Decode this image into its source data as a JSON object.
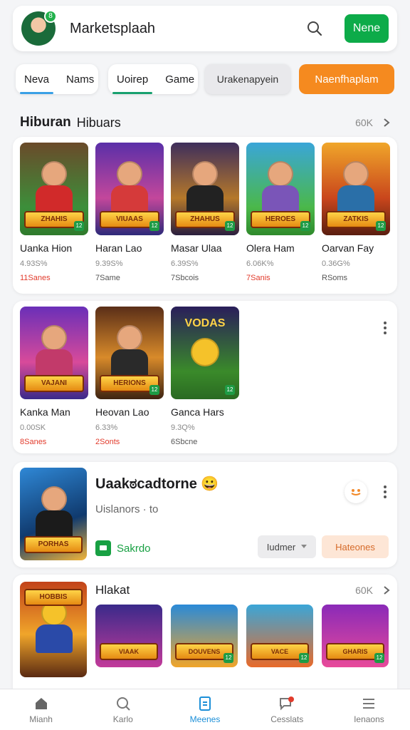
{
  "header": {
    "title": "Marketsplaah",
    "avatar_badge": "8",
    "cta_label": "Nene"
  },
  "chips": {
    "group1": [
      "Neva",
      "Nams"
    ],
    "group2": [
      "Uoirep",
      "Game"
    ],
    "grey": "Urakenapyein",
    "orange": "Naenfhaplam"
  },
  "section1": {
    "title": "Hiburan",
    "subtitle": "Hibuars",
    "more": "60K",
    "games": [
      {
        "name": "Uanka Hion",
        "rating": "4.93S%",
        "saves": "11Sanes",
        "red": true
      },
      {
        "name": "Haran Lao",
        "rating": "9.39S%",
        "saves": "7Same",
        "red": false
      },
      {
        "name": "Masar Ulaa",
        "rating": "6.39S%",
        "saves": "7Sbcois",
        "red": false
      },
      {
        "name": "Olera Ham",
        "rating": "6.06K%",
        "saves": "7Sanis",
        "red": true
      },
      {
        "name": "Oarvan Fay",
        "rating": "0.36G%",
        "saves": "RSoms",
        "red": false
      },
      {
        "name": "Kanka Man",
        "rating": "0.00SK",
        "saves": "8Sanes",
        "red": true
      },
      {
        "name": "Heovan Lao",
        "rating": "6.33%",
        "saves": "2Sonts",
        "red": true
      },
      {
        "name": "Ganca Hars",
        "rating": "9.3Q%",
        "saves": "6Sbcne",
        "red": false
      }
    ],
    "thumb_texts": [
      "ZHAHIS",
      "VIUAAS",
      "ZHAHUS",
      "HEROES",
      "ZATKIS",
      "VAJANI",
      "HERIONS",
      "VODAS"
    ]
  },
  "featured": {
    "title": "Uaakಠcadtorne 😀",
    "subtitle": "Uislanors  · to",
    "app_label": "Sakrdo",
    "dropdown": "Iudmer",
    "action": "Hateones",
    "thumb_text": "PORHAS"
  },
  "section2": {
    "title": "Hlakat",
    "more": "60K",
    "thumb_texts": [
      "HOBBIS",
      "VIAAK",
      "DOUVENS",
      "VACE",
      "GHARIS"
    ]
  },
  "nav": {
    "items": [
      {
        "label": "Mianh",
        "icon": "home-icon"
      },
      {
        "label": "Karlo",
        "icon": "search-icon"
      },
      {
        "label": "Meenes",
        "icon": "document-icon"
      },
      {
        "label": "Cesslats",
        "icon": "chat-icon"
      },
      {
        "label": "Ienaons",
        "icon": "menu-icon"
      }
    ],
    "active_index": 2
  },
  "colors": {
    "green": "#0dab49",
    "orange": "#f58a1f",
    "accent_blue": "#1c8fd8",
    "red": "#e23b2c"
  }
}
